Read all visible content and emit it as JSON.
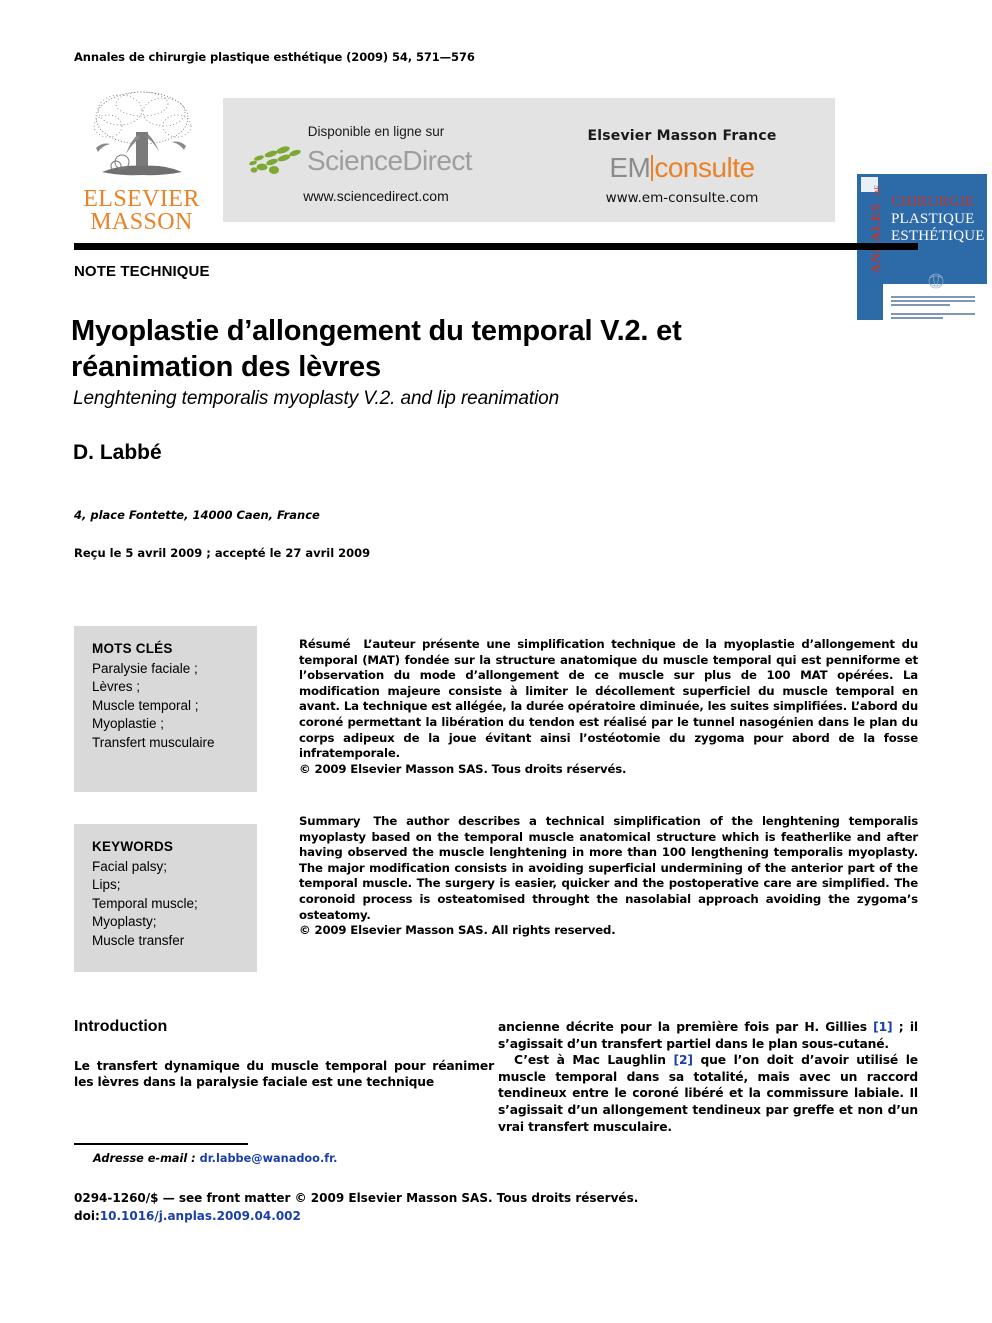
{
  "running_head": "Annales de chirurgie plastique esthétique (2009) 54, 571—576",
  "masthead": {
    "elsevier": {
      "line1": "ELSEVIER",
      "line2": "MASSON",
      "logo_icon": "elsevier-tree-logo",
      "color": "#E8832A"
    },
    "sciencedirect": {
      "available_text": "Disponible en ligne sur",
      "wordmark": "ScienceDirect",
      "url": "www.sciencedirect.com",
      "leaf_color": "#7DA832",
      "wordmark_color": "#9E9E9E"
    },
    "em_consulte": {
      "publisher": "Elsevier Masson France",
      "logo_part1": "EM",
      "logo_part2": "consulte",
      "url": "www.em-consulte.com",
      "accent_color": "#E8832A"
    },
    "cover": {
      "spine_label": "ANNALES",
      "spine_de": "DE",
      "title_line1": "CHIRURGIE",
      "title_line2": "PLASTIQUE",
      "title_line3": "ESTHÉTIQUE",
      "bg_color": "#2C6AA8",
      "accent_color": "#C3352B"
    }
  },
  "article": {
    "kicker": "NOTE TECHNIQUE",
    "title": "Myoplastie d’allongement du temporal V.2. et réanimation des lèvres",
    "subtitle": "Lenghtening temporalis myoplasty V.2. and lip reanimation",
    "author": "D. Labbé",
    "affiliation": "4, place Fontette, 14000 Caen, France",
    "history": "Reçu le 5 avril 2009 ; accepté le 27 avril 2009"
  },
  "keywords_fr": {
    "heading": "MOTS CLÉS",
    "items": [
      "Paralysie faciale ;",
      "Lèvres ;",
      "Muscle temporal ;",
      "Myoplastie ;",
      "Transfert musculaire"
    ]
  },
  "keywords_en": {
    "heading": "KEYWORDS",
    "items": [
      "Facial palsy;",
      "Lips;",
      "Temporal muscle;",
      "Myoplasty;",
      "Muscle transfer"
    ]
  },
  "abstract_fr": {
    "label": "Résumé",
    "text": "L’auteur présente une simplification technique de la myoplastie d’allongement du temporal (MAT) fondée sur la structure anatomique du muscle temporal qui est penniforme et l’observation du mode d’allongement de ce muscle sur plus de 100 MAT opérées. La modification majeure consiste à limiter le décollement superficiel du muscle temporal en avant. La technique est allégée, la durée opératoire diminuée, les suites simplifiées. L’abord du coroné permettant la libération du tendon est réalisé par le tunnel nasogénien dans le plan du corps adipeux de la joue évitant ainsi l’ostéotomie du zygoma pour abord de la fosse infratemporale.",
    "rights": "© 2009 Elsevier Masson SAS. Tous droits réservés."
  },
  "abstract_en": {
    "label": "Summary",
    "text": "The author describes a technical simplification of the lenghtening temporalis myoplasty based on the temporal muscle anatomical structure which is featherlike and after having observed the muscle lenghtening in more than 100 lengthening temporalis myoplasty. The major modification consists in avoiding superficial undermining of the anterior part of the temporal muscle. The surgery is easier, quicker and the postoperative care are simplified. The coronoid process is osteatomised throught the nasolabial approach avoiding the zygoma’s osteatomy.",
    "rights": "© 2009 Elsevier Masson SAS. All rights reserved."
  },
  "body": {
    "intro_heading": "Introduction",
    "left_paragraph": "Le transfert dynamique du muscle temporal pour réanimer les lèvres dans la paralysie faciale est une technique",
    "right_paragraph_1_part1": "ancienne décrite pour la première fois par H. Gillies ",
    "right_paragraph_1_ref": "[1]",
    "right_paragraph_1_part2": " ; il s’agissait d’un transfert partiel dans le plan sous-cutané.",
    "right_paragraph_2_part1": "C’est à Mac Laughlin ",
    "right_paragraph_2_ref": "[2]",
    "right_paragraph_2_part2": " que l’on doit d’avoir utilisé le muscle temporal dans sa totalité, mais avec un raccord tendineux entre le coroné libéré et la commissure labiale. Il s’agissait d’un allongement tendineux par greffe et non d’un vrai transfert musculaire."
  },
  "footnote": {
    "label": "Adresse e-mail :",
    "email": "dr.labbe@wanadoo.fr."
  },
  "footer": {
    "front_matter": "0294-1260/$ — see front matter © 2009 Elsevier Masson SAS. Tous droits réservés.",
    "doi_label": "doi:",
    "doi_value": "10.1016/j.anplas.2009.04.002"
  }
}
